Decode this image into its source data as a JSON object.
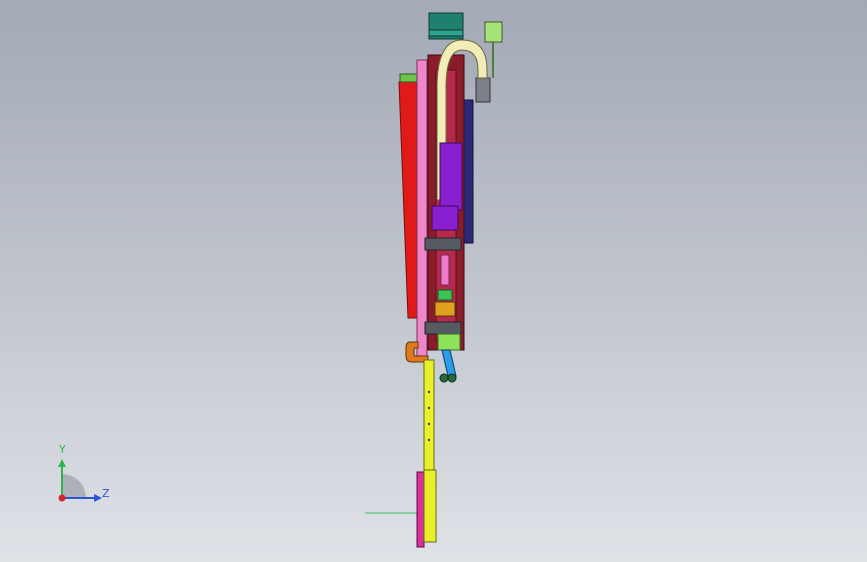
{
  "viewport": {
    "background_top": "#a3a9b5",
    "background_bottom": "#dfe2e7"
  },
  "triad": {
    "y_label": "Y",
    "z_label": "Z",
    "y_color": "#2fb34a",
    "z_color": "#2c55d6",
    "x_color": "#d62828"
  },
  "model": {
    "part_colors": {
      "red_plate": "#e01919",
      "pink_frame": "#ef86c8",
      "purple_column": "#8a1fd0",
      "dark_red_rail": "#8b1c2a",
      "cable_carrier": "#f2edb8",
      "teal_motor": "#1f8070",
      "light_green_box": "#a7e27a",
      "yellow_rod": "#e8f02a",
      "orange_hook": "#e07a1e",
      "blue_link": "#2e9be8",
      "navy_plate": "#2b2a7a"
    }
  }
}
